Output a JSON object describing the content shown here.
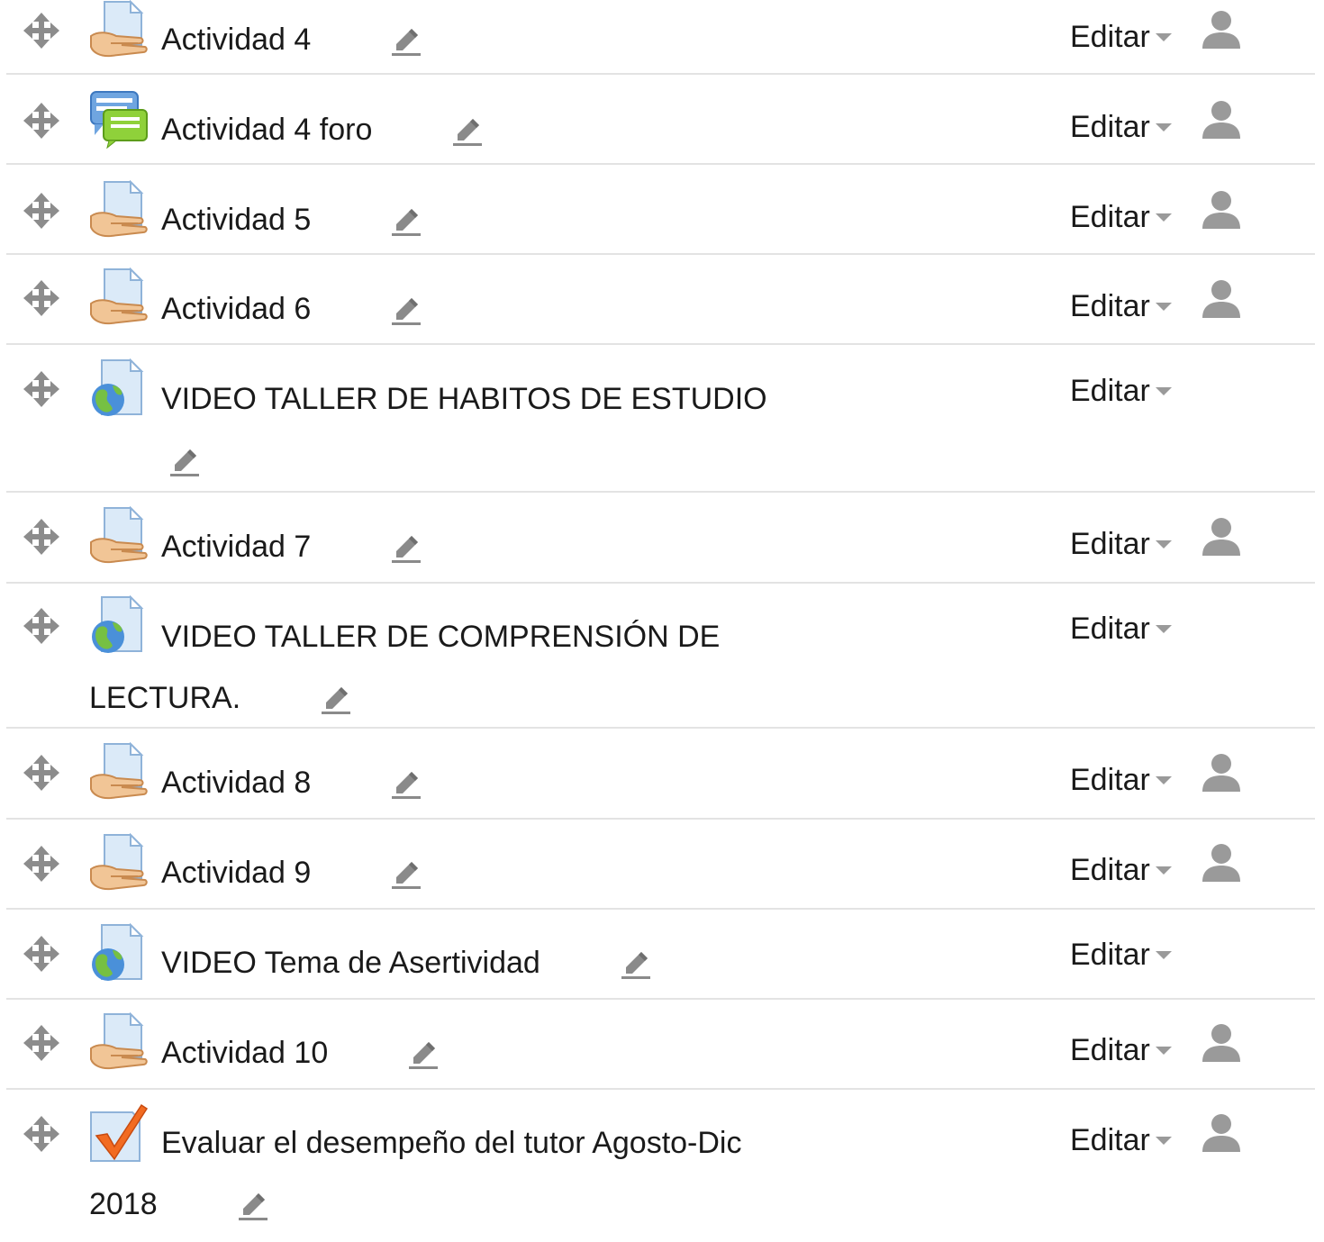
{
  "colors": {
    "separator": "#e3e3e3",
    "icon_grey": "#9a9a9a",
    "text": "#1a1a1a"
  },
  "icons": {
    "move": "move-arrows-icon",
    "edit": "pencil-icon",
    "caret": "caret-down-icon",
    "group_mode": "user-icon",
    "assignment": "assignment-icon",
    "forum": "forum-icon",
    "url": "url-globe-icon",
    "feedback": "feedback-check-icon"
  },
  "activities": [
    {
      "type": "assignment",
      "title": "Actividad 4",
      "edit_label": "Editar",
      "has_group_icon": true
    },
    {
      "type": "forum",
      "title": "Actividad 4 foro",
      "edit_label": "Editar",
      "has_group_icon": true
    },
    {
      "type": "assignment",
      "title": "Actividad 5",
      "edit_label": "Editar",
      "has_group_icon": true
    },
    {
      "type": "assignment",
      "title": "Actividad 6",
      "edit_label": "Editar",
      "has_group_icon": true
    },
    {
      "type": "url",
      "title": "VIDEO TALLER DE HABITOS DE ESTUDIO",
      "edit_label": "Editar",
      "has_group_icon": false
    },
    {
      "type": "assignment",
      "title": "Actividad 7",
      "edit_label": "Editar",
      "has_group_icon": true
    },
    {
      "type": "url",
      "title": "VIDEO TALLER DE COMPRENSIÓN DE LECTURA.",
      "edit_label": "Editar",
      "has_group_icon": false
    },
    {
      "type": "assignment",
      "title": "Actividad 8",
      "edit_label": "Editar",
      "has_group_icon": true
    },
    {
      "type": "assignment",
      "title": "Actividad 9",
      "edit_label": "Editar",
      "has_group_icon": true
    },
    {
      "type": "url",
      "title": "VIDEO Tema de Asertividad",
      "edit_label": "Editar",
      "has_group_icon": false
    },
    {
      "type": "assignment",
      "title": "Actividad 10",
      "edit_label": "Editar",
      "has_group_icon": true
    },
    {
      "type": "feedback",
      "title": "Evaluar el desempeño del tutor Agosto-Dic 2018",
      "edit_label": "Editar",
      "has_group_icon": true
    }
  ]
}
